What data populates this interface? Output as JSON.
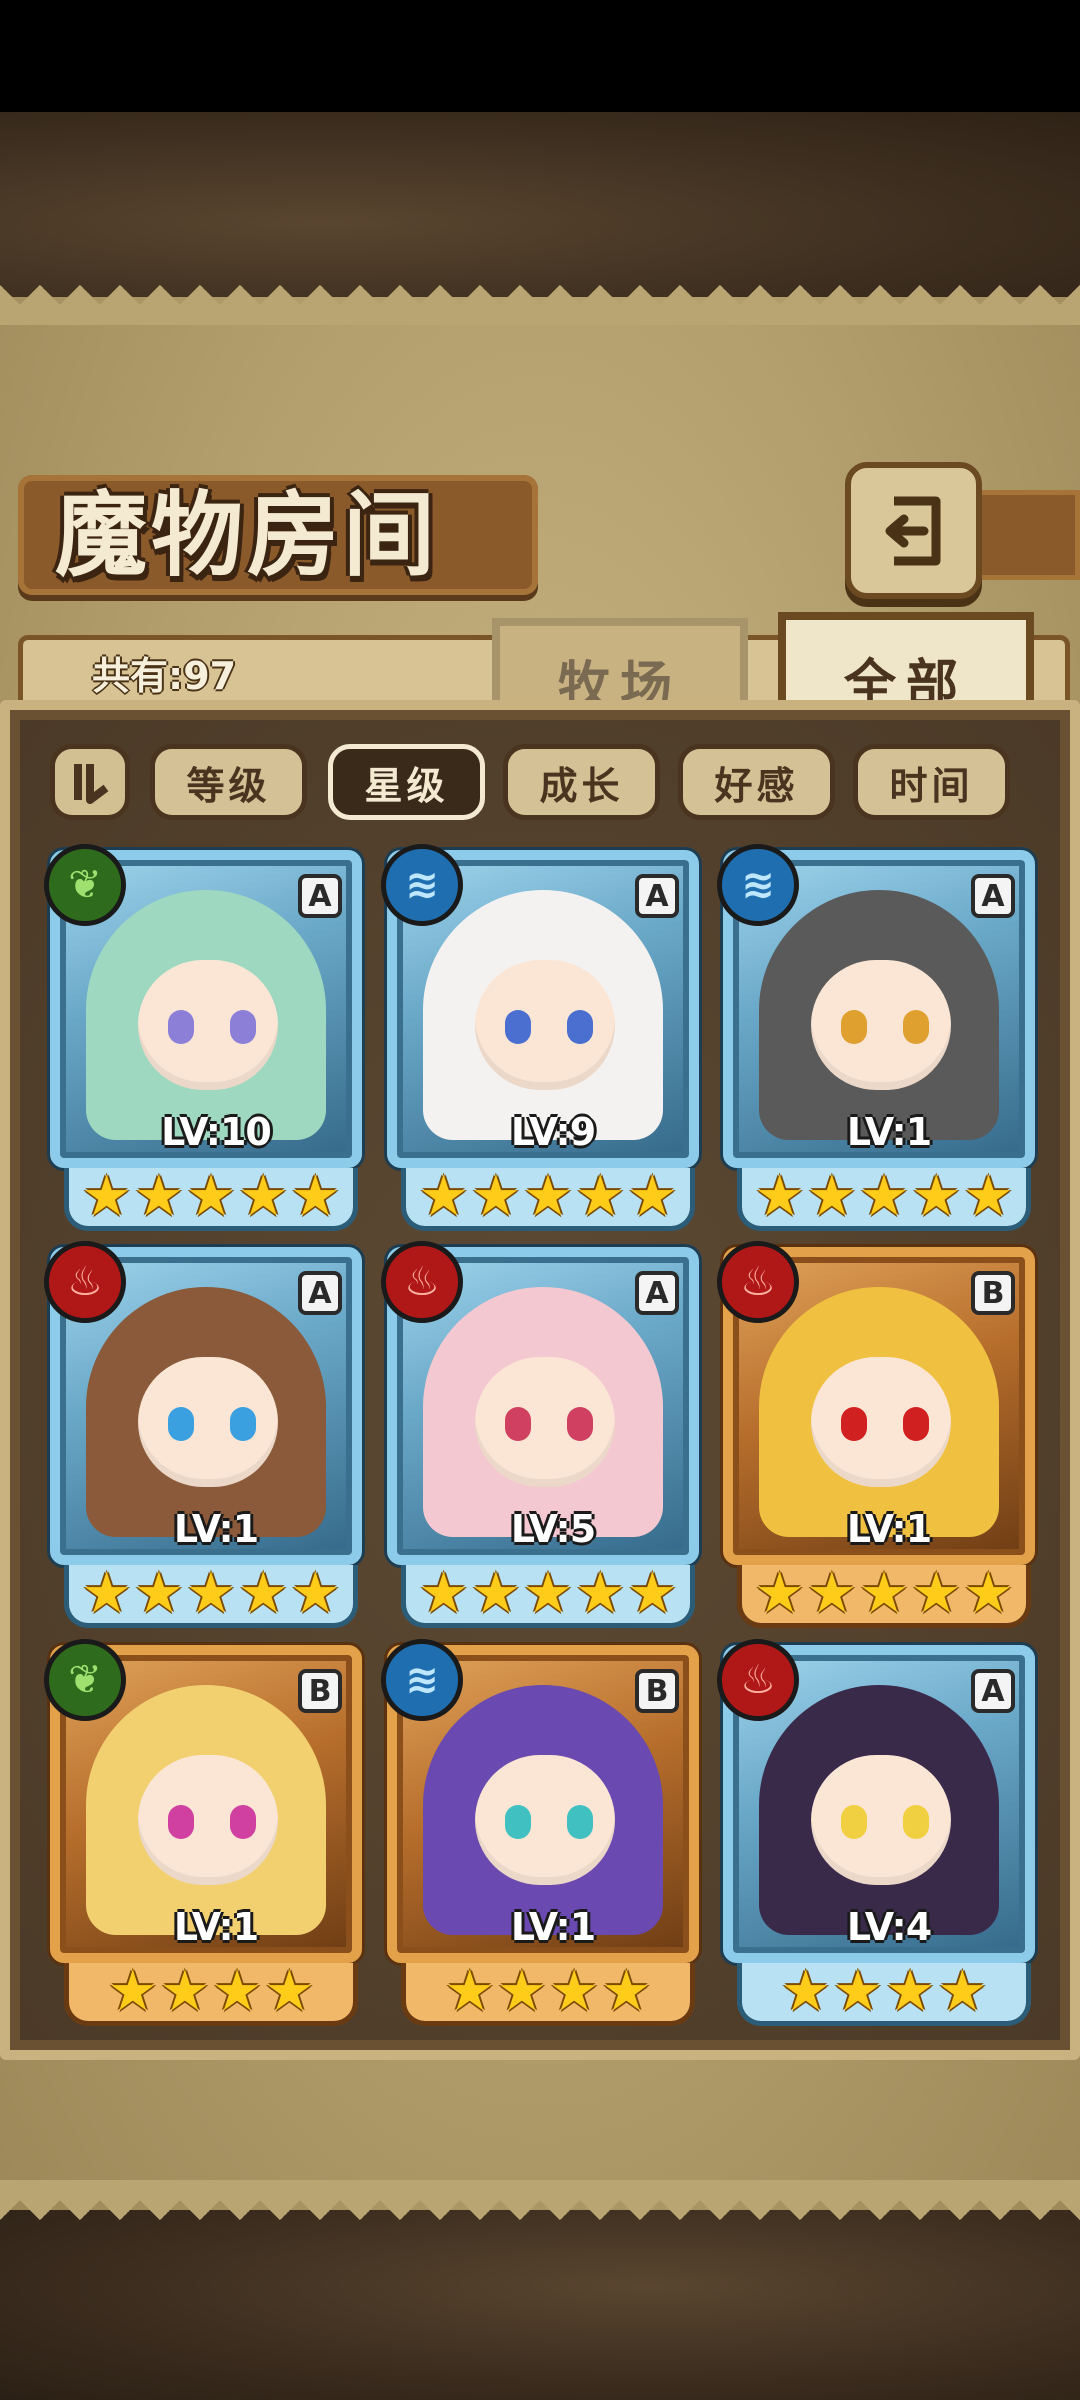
{
  "title": "魔物房间",
  "count_label": "共有:97",
  "tabs": {
    "ranch": "牧场",
    "all": "全部"
  },
  "sort_buttons": [
    "等级",
    "星级",
    "成长",
    "好感",
    "时间"
  ],
  "active_sort": "星级",
  "star_glyph": "★",
  "monsters": [
    {
      "element": "leaf",
      "rank": "A",
      "level": "LV:10",
      "stars": 5,
      "frame": "blue",
      "hair": "#9fd8c0",
      "eyes": "#8b7fd8"
    },
    {
      "element": "water",
      "rank": "A",
      "level": "LV:9",
      "stars": 5,
      "frame": "blue",
      "hair": "#f4f2f0",
      "eyes": "#4a6fd0"
    },
    {
      "element": "water",
      "rank": "A",
      "level": "LV:1",
      "stars": 5,
      "frame": "blue",
      "hair": "#5a5a5a",
      "eyes": "#e0a030"
    },
    {
      "element": "fire",
      "rank": "A",
      "level": "LV:1",
      "stars": 5,
      "frame": "blue",
      "hair": "#8a5a3a",
      "eyes": "#3aa0e0"
    },
    {
      "element": "fire",
      "rank": "A",
      "level": "LV:5",
      "stars": 5,
      "frame": "blue",
      "hair": "#f4c8d0",
      "eyes": "#d04060"
    },
    {
      "element": "fire",
      "rank": "B",
      "level": "LV:1",
      "stars": 5,
      "frame": "gold",
      "hair": "#f0c040",
      "eyes": "#d02020"
    },
    {
      "element": "leaf",
      "rank": "B",
      "level": "LV:1",
      "stars": 4,
      "frame": "gold",
      "hair": "#f2d070",
      "eyes": "#d040a0"
    },
    {
      "element": "water",
      "rank": "B",
      "level": "LV:1",
      "stars": 4,
      "frame": "gold",
      "hair": "#6a4ab0",
      "eyes": "#40c0c0"
    },
    {
      "element": "fire",
      "rank": "A",
      "level": "LV:4",
      "stars": 4,
      "frame": "blue",
      "hair": "#3a2a4a",
      "eyes": "#f0d040"
    }
  ],
  "colors": {
    "leaf": "#2f6b1c",
    "water": "#1f6eb0",
    "fire": "#b01818"
  }
}
